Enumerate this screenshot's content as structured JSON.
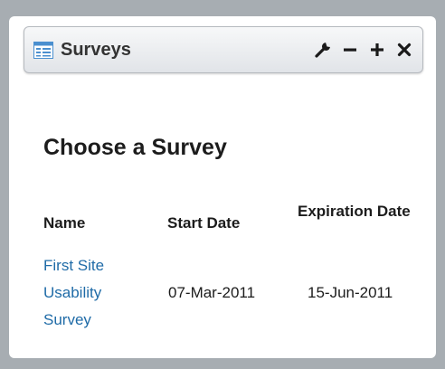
{
  "window": {
    "title": "Surveys",
    "icon": "list-window-icon",
    "controls": [
      {
        "name": "configure",
        "icon": "wrench-icon"
      },
      {
        "name": "minimize",
        "icon": "minus-icon"
      },
      {
        "name": "maximize",
        "icon": "plus-icon"
      },
      {
        "name": "close",
        "icon": "close-icon"
      }
    ]
  },
  "content": {
    "heading": "Choose a Survey",
    "table": {
      "columns": [
        "Name",
        "Start Date",
        "Expiration Date"
      ],
      "rows": [
        {
          "name": "First Site Usability Survey",
          "start_date": "07-Mar-2011",
          "expiration_date": "15-Jun-2011"
        }
      ]
    }
  },
  "colors": {
    "page_background": "#a7adb2",
    "link": "#1f6ba7",
    "icon_accent": "#4a8fcf"
  }
}
